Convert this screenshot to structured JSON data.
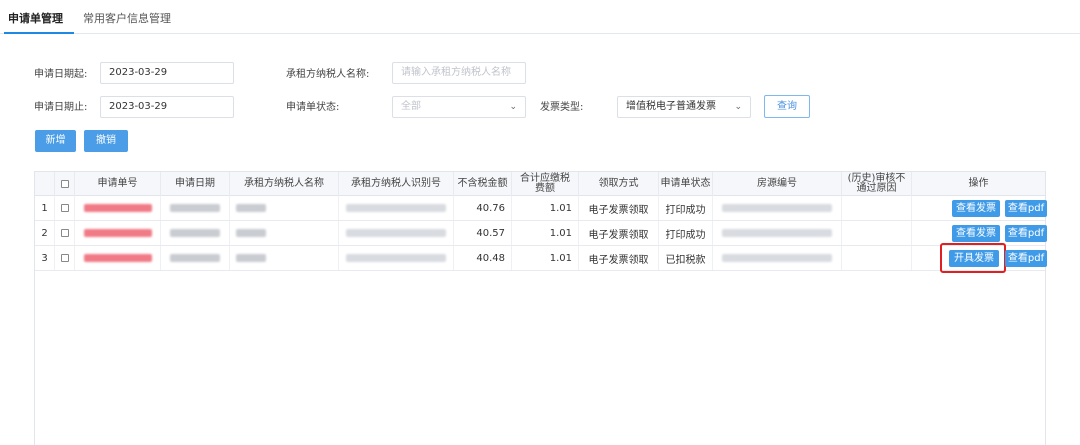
{
  "tabs": [
    {
      "label": "申请单管理",
      "active": true
    },
    {
      "label": "常用客户信息管理",
      "active": false
    }
  ],
  "filters": {
    "date_start_label": "申请日期起:",
    "date_start_value": "2023-03-29",
    "taxpayer_name_label": "承租方纳税人名称:",
    "taxpayer_name_placeholder": "请输入承租方纳税人名称",
    "date_end_label": "申请日期止:",
    "date_end_value": "2023-03-29",
    "status_label": "申请单状态:",
    "status_placeholder": "全部",
    "invoice_type_label": "发票类型:",
    "invoice_type_value": "增值税电子普通发票",
    "query_label": "查询"
  },
  "toolbar": {
    "add_label": "新增",
    "revoke_label": "撤销"
  },
  "table": {
    "headers": {
      "app_no": "申请单号",
      "app_date": "申请日期",
      "taxpayer_name": "承租方纳税人名称",
      "taxpayer_id": "承租方纳税人识别号",
      "amount_ex_tax": "不含税金额",
      "tax_due_1": "合计应缴税",
      "tax_due_2": "费额",
      "receive_method": "领取方式",
      "status": "申请单状态",
      "source_no": "房源编号",
      "reject_1": "(历史)审核不",
      "reject_2": "通过原因",
      "actions": "操作"
    },
    "rows": [
      {
        "num": "1",
        "amount": "40.76",
        "tax": "1.01",
        "method": "电子发票领取",
        "status": "打印成功",
        "action1": "查看发票",
        "action2": "查看pdf"
      },
      {
        "num": "2",
        "amount": "40.57",
        "tax": "1.01",
        "method": "电子发票领取",
        "status": "打印成功",
        "action1": "查看发票",
        "action2": "查看pdf"
      },
      {
        "num": "3",
        "amount": "40.48",
        "tax": "1.01",
        "method": "电子发票领取",
        "status": "已扣税款",
        "action1": "开具发票",
        "action2": "查看pdf"
      }
    ]
  },
  "colors": {
    "accent": "#1e88e5",
    "button_blue": "#4a9de6",
    "highlight_red": "#e02020"
  }
}
